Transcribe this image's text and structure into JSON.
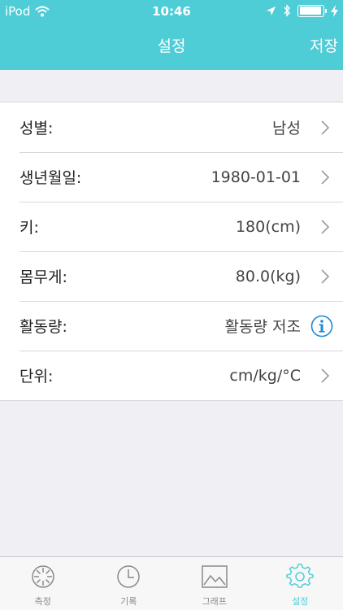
{
  "status": {
    "carrier": "iPod",
    "time": "10:46",
    "icons": [
      "wifi-icon",
      "location-arrow-icon",
      "bluetooth-icon",
      "battery-icon",
      "charging-bolt-icon"
    ]
  },
  "nav": {
    "title": "설정",
    "save_label": "저장"
  },
  "settings": [
    {
      "label": "성별:",
      "value": "남성",
      "accessory": "chevron"
    },
    {
      "label": "생년월일:",
      "value": "1980-01-01",
      "accessory": "chevron"
    },
    {
      "label": "키:",
      "value": "180(cm)",
      "accessory": "chevron"
    },
    {
      "label": "몸무게:",
      "value": "80.0(kg)",
      "accessory": "chevron"
    },
    {
      "label": "활동량:",
      "value": "활동량 저조",
      "accessory": "info"
    },
    {
      "label": "단위:",
      "value": "cm/kg/°C",
      "accessory": "chevron"
    }
  ],
  "tabs": [
    {
      "label": "측정",
      "icon": "measure-icon",
      "active": false
    },
    {
      "label": "기록",
      "icon": "clock-icon",
      "active": false
    },
    {
      "label": "그래프",
      "icon": "graph-image-icon",
      "active": false
    },
    {
      "label": "설정",
      "icon": "gear-icon",
      "active": true
    }
  ],
  "colors": {
    "accent": "#4ecdd7",
    "background": "#efeff4",
    "info_blue": "#1e88d8"
  }
}
